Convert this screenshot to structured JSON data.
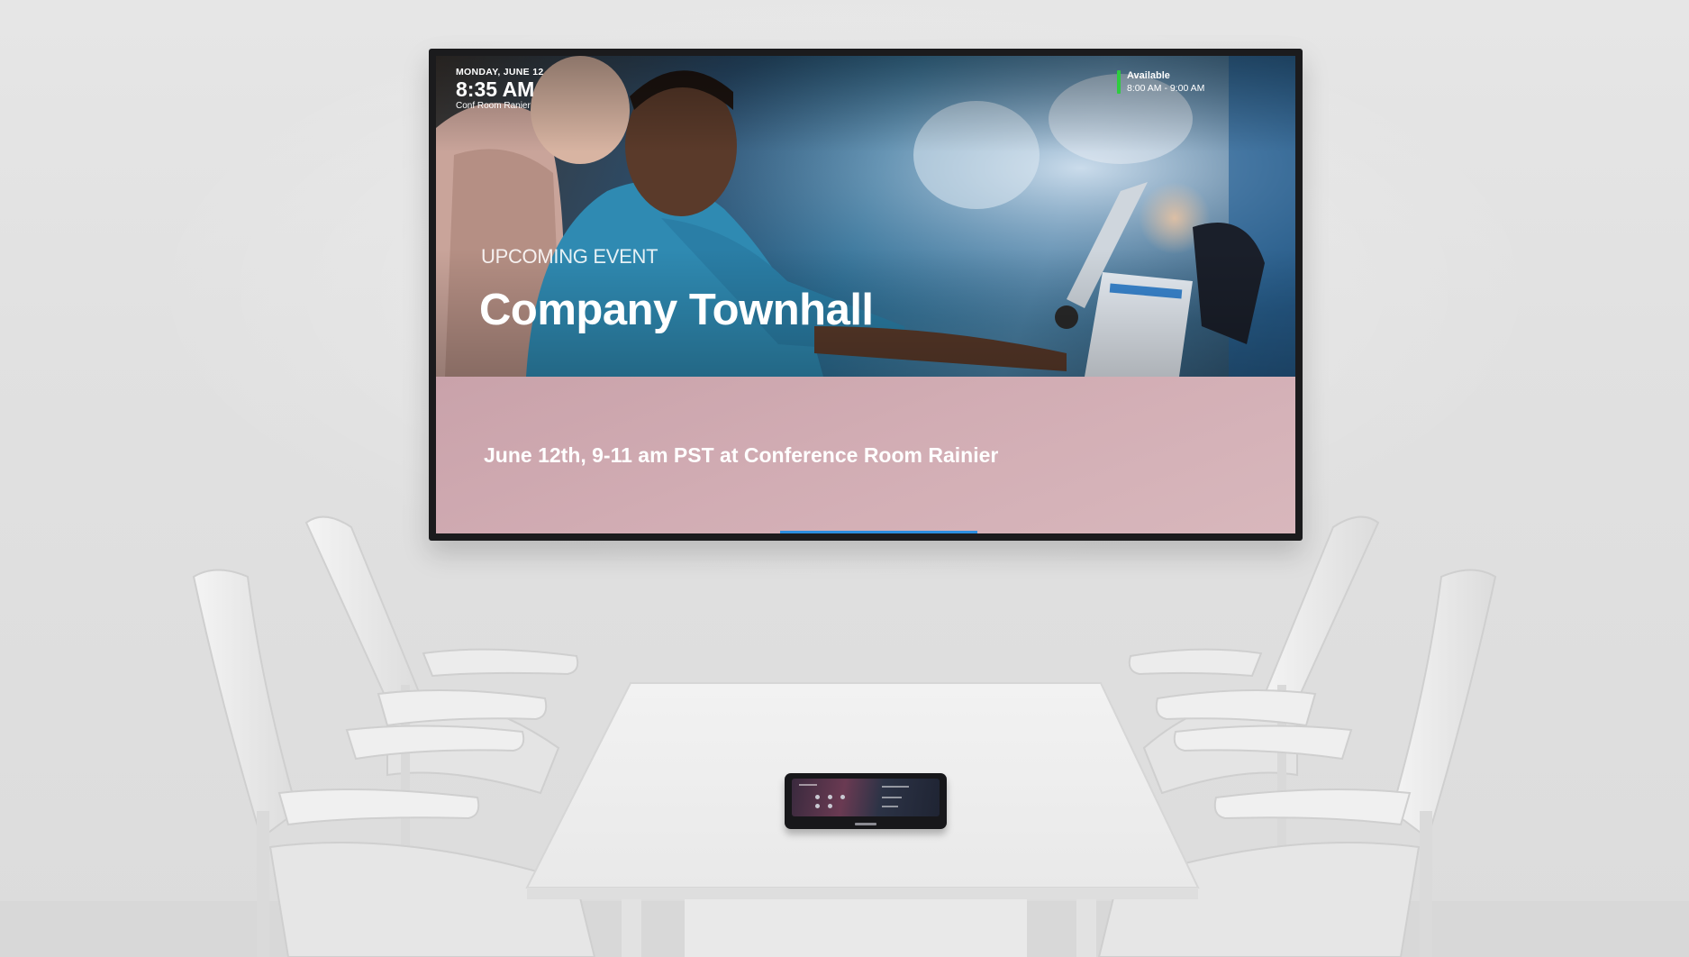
{
  "display": {
    "date": "MONDAY, JUNE 12",
    "time": "8:35 AM",
    "room": "Conf Room Ranier",
    "status": {
      "label": "Available",
      "time_range": "8:00 AM - 9:00 AM",
      "color": "#2ecc40"
    },
    "event": {
      "label": "UPCOMING EVENT",
      "title": "Company Townhall",
      "details": "June 12th, 9-11 am PST at Conference Room Rainier"
    },
    "band_color": "#d2adb4",
    "progress": {
      "fraction": 0.23,
      "color": "#2d8fe0"
    }
  },
  "scene": {
    "wall_color": "#e3e3e3",
    "table_color": "#f0f0f0",
    "chair_color": "#ededed"
  }
}
